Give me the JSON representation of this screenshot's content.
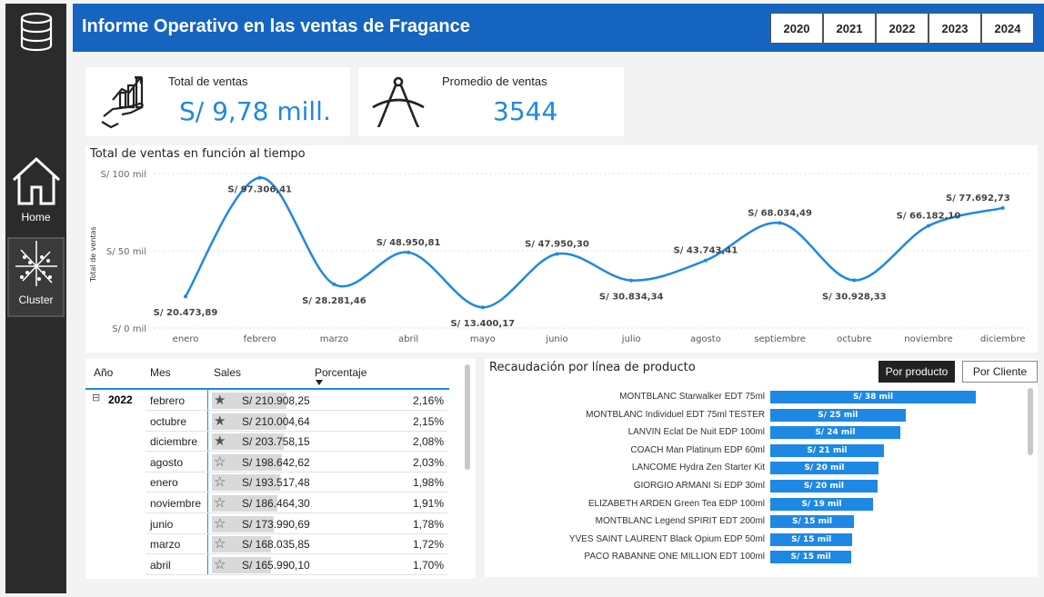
{
  "header": {
    "title": "Informe Operativo en las ventas de Fragance",
    "years": [
      "2020",
      "2021",
      "2022",
      "2023",
      "2024"
    ]
  },
  "sidebar": {
    "items": [
      {
        "label": "Home",
        "icon": "home-icon"
      },
      {
        "label": "Cluster",
        "icon": "cluster-icon"
      }
    ]
  },
  "kpis": {
    "total_label": "Total de ventas",
    "total_value": "S/ 9,78 mill.",
    "avg_label": "Promedio de ventas",
    "avg_value": "3544"
  },
  "line_chart": {
    "title": "Total de ventas en función al tiempo",
    "ylabel": "Total de ventas",
    "yticks": [
      "S/ 100 mil",
      "S/ 50 mil",
      "S/ 0 mil"
    ],
    "color": "#1e88e5"
  },
  "chart_data": {
    "type": "line",
    "categories": [
      "enero",
      "febrero",
      "marzo",
      "abril",
      "mayo",
      "junio",
      "julio",
      "agosto",
      "septiembre",
      "octubre",
      "noviembre",
      "diciembre"
    ],
    "values": [
      20473.89,
      97306.41,
      28281.46,
      48950.81,
      13400.17,
      47950.3,
      30834.34,
      43743.41,
      68034.49,
      30928.33,
      66182.1,
      77692.73
    ],
    "labels": [
      "S/ 20.473,89",
      "S/ 97.306,41",
      "S/ 28.281,46",
      "S/ 48.950,81",
      "S/ 13.400,17",
      "S/ 47.950,30",
      "S/ 30.834,34",
      "S/ 43.743,41",
      "S/ 68.034,49",
      "S/ 30.928,33",
      "S/ 66.182,10",
      "S/ 77.692,73"
    ],
    "ylim": [
      0,
      100000
    ],
    "grid": true
  },
  "table": {
    "headers": [
      "Año",
      "Mes",
      "Sales",
      "Porcentaje"
    ],
    "year": "2022",
    "expand_symbol": "⊟",
    "rows": [
      {
        "mes": "febrero",
        "sales": "S/ 210.908,25",
        "value": 210908.25,
        "pct": "2,16%",
        "star": "★"
      },
      {
        "mes": "octubre",
        "sales": "S/ 210.004,64",
        "value": 210004.64,
        "pct": "2,15%",
        "star": "★"
      },
      {
        "mes": "diciembre",
        "sales": "S/ 203.758,15",
        "value": 203758.15,
        "pct": "2,08%",
        "star": "★"
      },
      {
        "mes": "agosto",
        "sales": "S/ 198.642,62",
        "value": 198642.62,
        "pct": "2,03%",
        "star": "☆"
      },
      {
        "mes": "enero",
        "sales": "S/ 193.517,48",
        "value": 193517.48,
        "pct": "1,98%",
        "star": "☆"
      },
      {
        "mes": "noviembre",
        "sales": "S/ 186.464,30",
        "value": 186464.3,
        "pct": "1,91%",
        "star": "☆"
      },
      {
        "mes": "junio",
        "sales": "S/ 173.990,69",
        "value": 173990.69,
        "pct": "1,78%",
        "star": "☆"
      },
      {
        "mes": "marzo",
        "sales": "S/ 168.035,85",
        "value": 168035.85,
        "pct": "1,72%",
        "star": "☆"
      },
      {
        "mes": "abril",
        "sales": "S/ 165.990,10",
        "value": 165990.1,
        "pct": "1,70%",
        "star": "☆"
      }
    ]
  },
  "product_chart": {
    "title": "Recaudación por línea de producto",
    "toggle_active": "Por producto",
    "toggle_other": "Por Cliente",
    "color": "#1e88e5",
    "products": [
      {
        "name": "MONTBLANC Starwalker EDT 75ml",
        "label": "S/ 38 mil",
        "value": 38
      },
      {
        "name": "MONTBLANC Individuel EDT 75ml TESTER",
        "label": "S/ 25 mil",
        "value": 25
      },
      {
        "name": "LANVIN Eclat De Nuit EDP 100ml",
        "label": "S/ 24 mil",
        "value": 24
      },
      {
        "name": "COACH Man Platinum EDP 60ml",
        "label": "S/ 21 mil",
        "value": 21
      },
      {
        "name": "LANCOME Hydra Zen Starter Kit",
        "label": "S/ 20 mil",
        "value": 20
      },
      {
        "name": "GIORGIO ARMANI Si EDP 30ml",
        "label": "S/ 20 mil",
        "value": 19.8
      },
      {
        "name": "ELIZABETH ARDEN Green Tea EDP 100ml",
        "label": "S/ 19 mil",
        "value": 19
      },
      {
        "name": "MONTBLANC Legend SPIRIT EDT 200ml",
        "label": "S/ 15 mil",
        "value": 15.5
      },
      {
        "name": "YVES SAINT LAURENT Black Opium EDP 50ml",
        "label": "S/ 15 mil",
        "value": 15.2
      },
      {
        "name": "PACO RABANNE ONE MILLION EDT 100ml",
        "label": "S/ 15 mil",
        "value": 15
      }
    ]
  }
}
